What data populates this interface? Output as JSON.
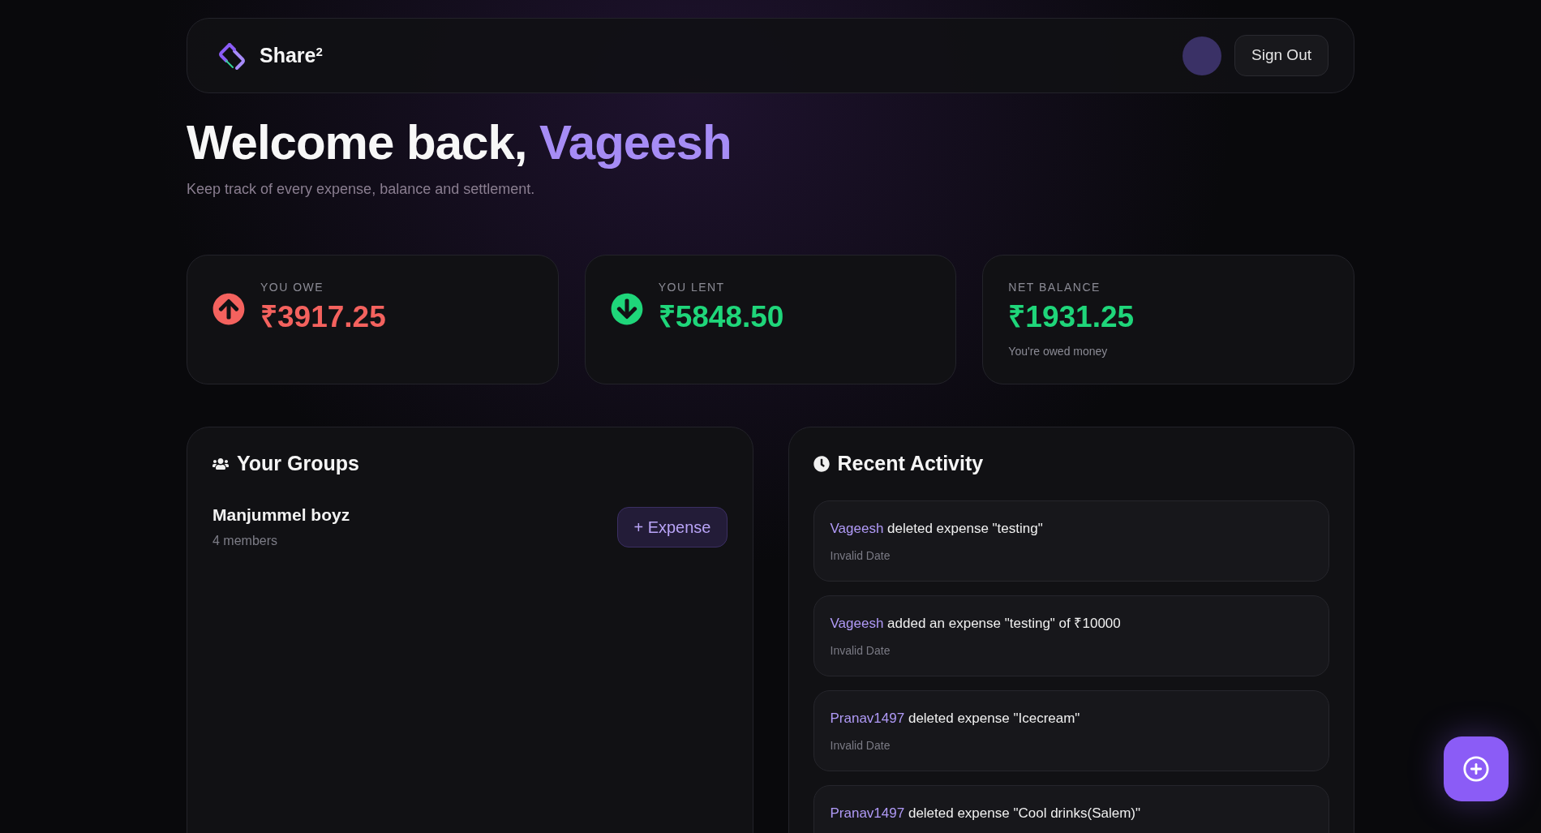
{
  "header": {
    "brand": "Share$^{2}$",
    "sign_out": "Sign Out"
  },
  "hero": {
    "greeting": "Welcome back,",
    "name": "Vageesh",
    "subtitle": "Keep track of every expense, balance and settlement."
  },
  "stats": [
    {
      "kind": "owe",
      "label": "YOU OWE",
      "amount": "₹3917.25"
    },
    {
      "kind": "lent",
      "label": "YOU LENT",
      "amount": "₹5848.50"
    },
    {
      "kind": "net",
      "label": "NET BALANCE",
      "amount": "₹1931.25",
      "note": "You're owed money"
    }
  ],
  "groups": {
    "title": "Your Groups",
    "items": [
      {
        "name": "Manjummel boyz",
        "members": "4 members",
        "button": "+ Expense"
      }
    ]
  },
  "activity": {
    "title": "Recent Activity",
    "items": [
      {
        "user": "Vageesh",
        "action": "deleted expense \"testing\"",
        "date": "Invalid Date"
      },
      {
        "user": "Vageesh",
        "action": "added an expense \"testing\" of ₹10000",
        "date": "Invalid Date"
      },
      {
        "user": "Pranav1497",
        "action": "deleted expense \"Icecream\"",
        "date": "Invalid Date"
      },
      {
        "user": "Pranav1497",
        "action": "deleted expense \"Cool drinks(Salem)\""
      }
    ]
  }
}
